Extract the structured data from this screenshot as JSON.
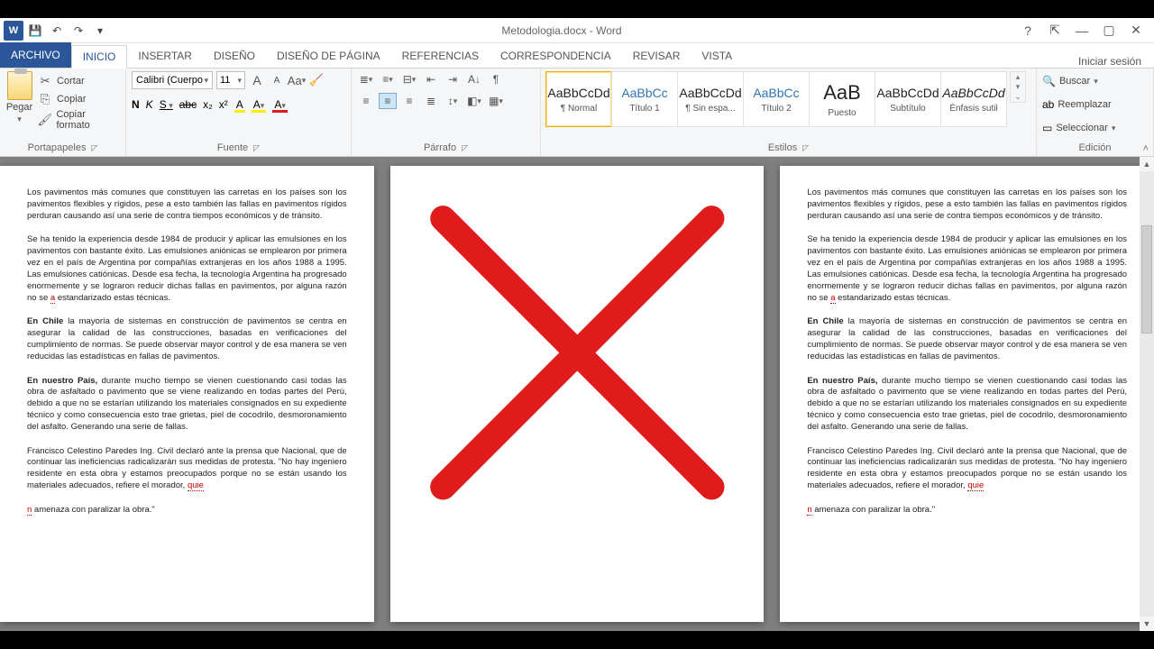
{
  "title": "Metodologia.docx - Word",
  "qat": {
    "save": "💾",
    "undo": "↶",
    "redo": "↷",
    "more": "▾"
  },
  "wincontrols": {
    "help": "?",
    "displayopts": "⇱",
    "min": "—",
    "restore": "▢",
    "close": "✕"
  },
  "tabs": {
    "file": "ARCHIVO",
    "home": "INICIO",
    "insert": "INSERTAR",
    "design": "DISEÑO",
    "layout": "DISEÑO DE PÁGINA",
    "references": "REFERENCIAS",
    "mailings": "CORRESPONDENCIA",
    "review": "REVISAR",
    "view": "VISTA"
  },
  "signin": "Iniciar sesión",
  "groups": {
    "clipboard": "Portapapeles",
    "font": "Fuente",
    "paragraph": "Párrafo",
    "styles": "Estilos",
    "editing": "Edición"
  },
  "clipboard": {
    "paste": "Pegar",
    "cut": "Cortar",
    "copy": "Copiar",
    "painter": "Copiar formato"
  },
  "font": {
    "name": "Calibri (Cuerpo",
    "size": "11",
    "grow": "A",
    "shrink": "A",
    "case": "Aa",
    "clear": "⌫",
    "bold": "N",
    "italic": "K",
    "underline": "S",
    "strike": "abc",
    "sub": "x₂",
    "sup": "x²",
    "effects": "A",
    "highlight": "A",
    "color": "A"
  },
  "styles": [
    {
      "preview": "AaBbCcDd",
      "name": "¶ Normal",
      "sel": true,
      "cls": ""
    },
    {
      "preview": "AaBbCc",
      "name": "Título 1",
      "sel": false,
      "cls": "blue"
    },
    {
      "preview": "AaBbCcDd",
      "name": "¶ Sin espa...",
      "sel": false,
      "cls": ""
    },
    {
      "preview": "AaBbCc",
      "name": "Título 2",
      "sel": false,
      "cls": "blue"
    },
    {
      "preview": "AaB",
      "name": "Puesto",
      "sel": false,
      "cls": "big"
    },
    {
      "preview": "AaBbCcDd",
      "name": "Subtítulo",
      "sel": false,
      "cls": ""
    },
    {
      "preview": "AaBbCcDd",
      "name": "Énfasis sutil",
      "sel": false,
      "cls": "ital"
    }
  ],
  "editing": {
    "find": "Buscar",
    "replace": "Reemplazar",
    "select": "Seleccionar"
  },
  "doc": {
    "p1": "Los pavimentos más comunes que constituyen las carretas en los países son los pavimentos flexibles y rígidos, pese a esto también las fallas en pavimentos rígidos perduran causando así una serie de contra tiempos económicos y de tránsito.",
    "p2": "Se ha tenido la experiencia desde 1984 de producir y aplicar las emulsiones en los pavimentos con bastante éxito.  Las emulsiones aniónicas se emplearon por primera vez en el país de Argentina por compañías extranjeras en los años 1988 a 1995. Las emulsiones catiónicas. Desde esa fecha, la tecnología Argentina ha progresado enormemente y se lograron reducir dichas fallas en pavimentos, por alguna razón no se ",
    "p2err": "a",
    "p2b": " estandarizado estas técnicas.",
    "p3a": "En Chile",
    "p3": " la mayoría de sistemas en construcción de pavimentos se centra en asegurar la calidad de las construcciones, basadas en verificaciones del cumplimiento de normas. Se puede observar mayor control y de esa manera se ven reducidas las estadísticas en fallas de pavimentos.",
    "p4a": "En nuestro País,",
    "p4": " durante mucho tiempo se vienen cuestionando casi todas las  obra de asfaltado o pavimento que se viene realizando en todas partes del Perú, debido a que no se estarían utilizando los materiales consignados en su expediente técnico y como consecuencia esto trae grietas, piel de cocodrilo, desmoronamiento del asfalto. Generando una serie de fallas.",
    "p5": "Francisco Celestino Paredes Ing. Civil declaró ante la prensa que Nacional,  que de continuar las ineficiencias radicalizarán sus medidas de protesta. \"No hay ingeniero residente en esta obra y estamos preocupados porque no se están usando los materiales adecuados, refiere el morador, ",
    "p5err": "quie",
    "p6err": "n",
    "p6": " amenaza con paralizar la obra.\""
  }
}
